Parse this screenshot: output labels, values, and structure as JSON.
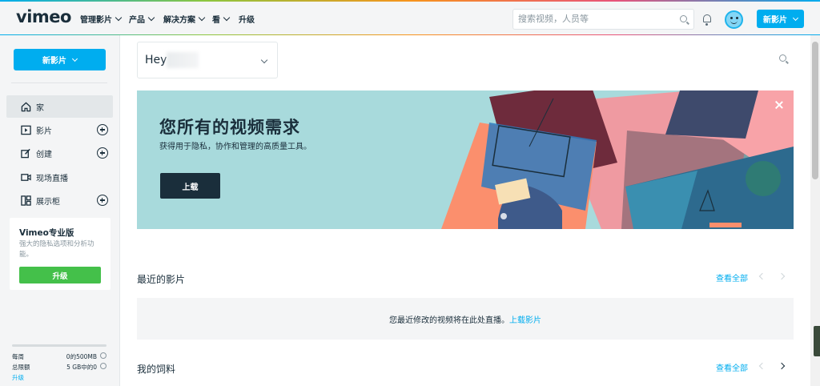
{
  "nav": {
    "logo": "vimeo",
    "items": [
      "管理影片",
      "产品",
      "解决方案",
      "看",
      "升级"
    ],
    "search_placeholder": "搜索视频，人员等",
    "new_video_label": "新影片"
  },
  "sidebar": {
    "new_video_label": "新影片",
    "items": [
      {
        "label": "家",
        "icon": "home-icon"
      },
      {
        "label": "影片",
        "icon": "video-icon"
      },
      {
        "label": "创建",
        "icon": "create-icon"
      },
      {
        "label": "现场直播",
        "icon": "livestream-icon"
      },
      {
        "label": "展示柜",
        "icon": "showcase-icon"
      }
    ],
    "pro": {
      "title": "Vimeo专业版",
      "desc": "强大的隐私选项和分析功能。",
      "button": "升级"
    },
    "usage": {
      "progress": 0,
      "weekly_label": "每周",
      "weekly_value": "0的500MB",
      "total_label": "总限额",
      "total_value": "5 GB中的0",
      "upgrade_link": "升级"
    }
  },
  "main": {
    "team_title": "Hey",
    "banner": {
      "title": "您所有的视频需求",
      "subtitle": "获得用于隐私，协作和管理的高质量工具。",
      "button": "上载"
    },
    "recent": {
      "title": "最近的影片",
      "see_all": "查看全部",
      "empty_msg": "您最近修改的视频将在此处直播。",
      "empty_link": "上载影片"
    },
    "feed": {
      "title": "我的饲料",
      "see_all": "查看全部"
    }
  },
  "colors": {
    "accent": "#00adef",
    "green": "#44c04a",
    "dark": "#1a2e3b",
    "banner_bg": "#a8dadc"
  }
}
